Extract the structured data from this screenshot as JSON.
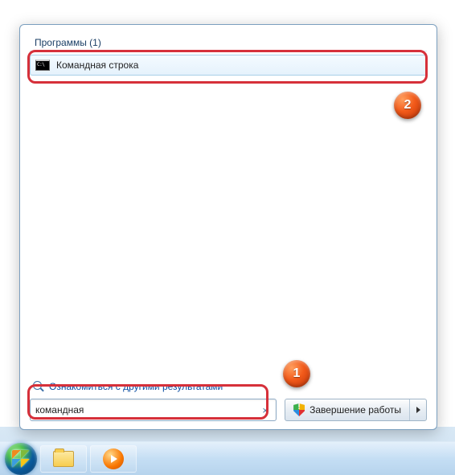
{
  "category": {
    "label": "Программы (1)"
  },
  "results": [
    {
      "label": "Командная строка",
      "icon": "cmd-icon"
    }
  ],
  "see_more": {
    "label": "Ознакомиться с другими результатами"
  },
  "search": {
    "value": "командная",
    "clear_glyph": "×"
  },
  "shutdown": {
    "label": "Завершение работы"
  },
  "annotations": {
    "badge1": "1",
    "badge2": "2"
  }
}
